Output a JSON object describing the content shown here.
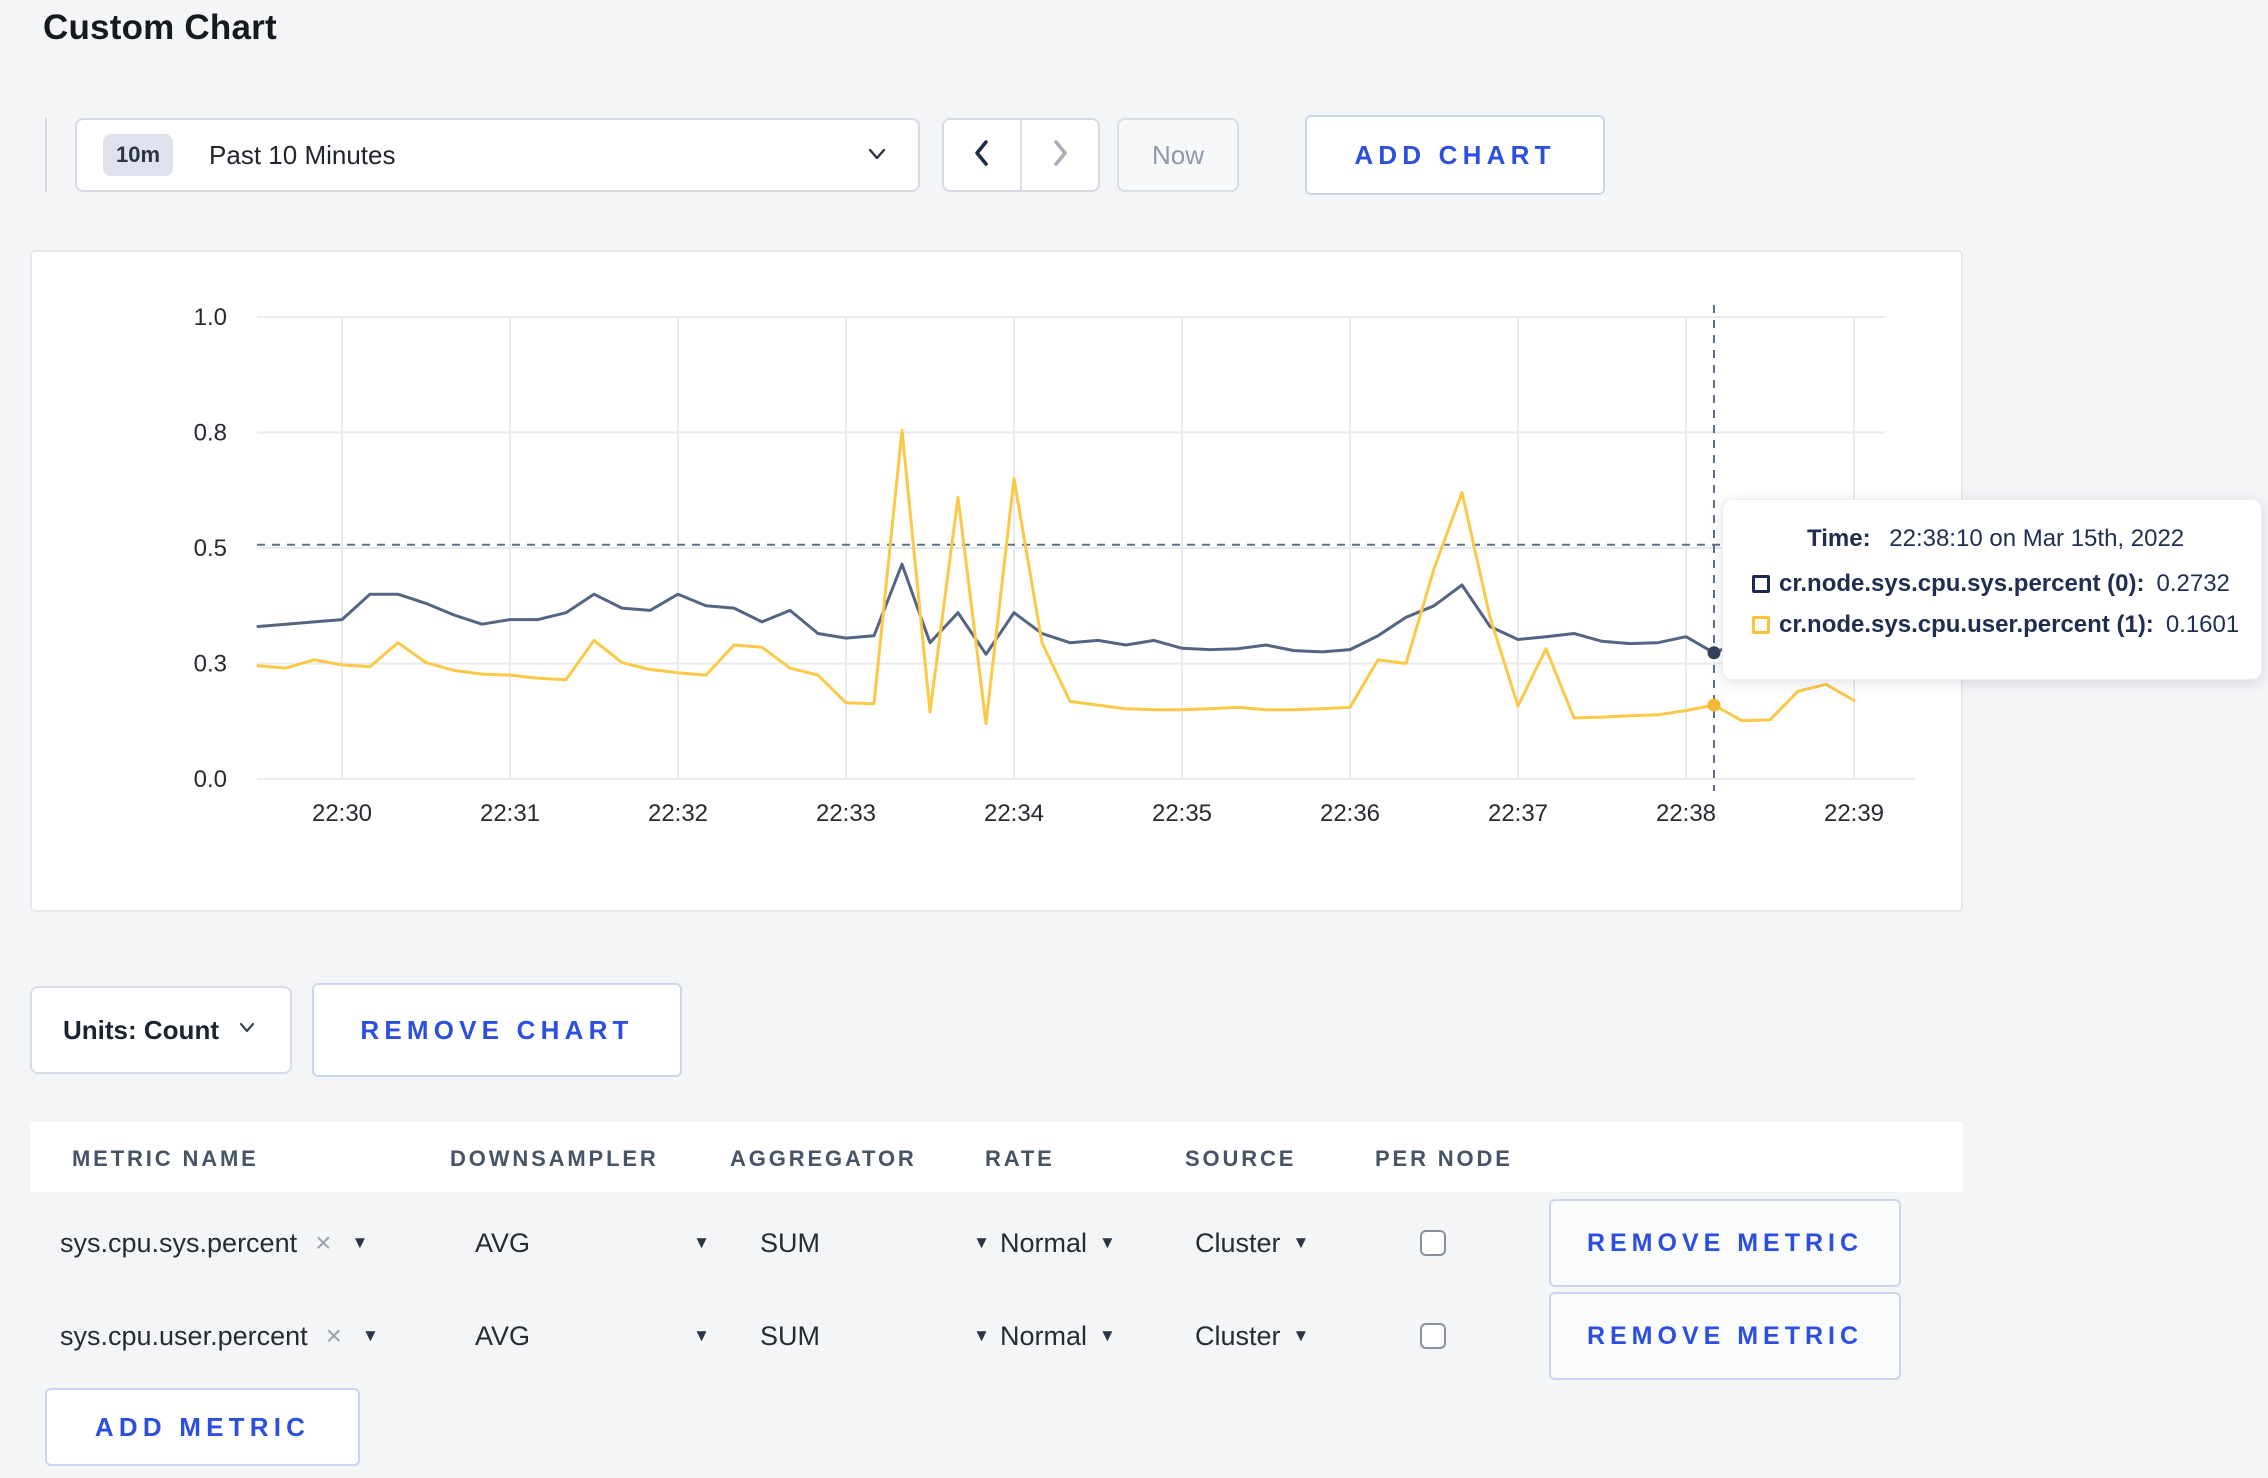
{
  "page": {
    "title": "Custom Chart"
  },
  "toolbar": {
    "time_window_badge": "10m",
    "time_window_label": "Past 10 Minutes",
    "now_label": "Now",
    "add_chart_label": "ADD CHART"
  },
  "chart_data": {
    "type": "line",
    "title": "",
    "xlabel": "",
    "ylabel": "",
    "x_tick_labels": [
      "22:30",
      "22:31",
      "22:32",
      "22:33",
      "22:34",
      "22:35",
      "22:36",
      "22:37",
      "22:38",
      "22:39"
    ],
    "y_tick_values": [
      0,
      0.25,
      0.5,
      0.75,
      1.0
    ],
    "y_tick_labels": [
      "0.0",
      "0.3",
      "0.5",
      "0.8",
      "1.0"
    ],
    "ylim": [
      0,
      1
    ],
    "grid": true,
    "x_start_time": "22:29:30",
    "sample_interval_seconds": 10,
    "series": [
      {
        "name": "cr.node.sys.cpu.sys.percent (0)",
        "color": "#546584",
        "values": [
          0.33,
          0.335,
          0.34,
          0.345,
          0.4,
          0.4,
          0.38,
          0.355,
          0.335,
          0.345,
          0.345,
          0.36,
          0.4,
          0.37,
          0.365,
          0.4,
          0.375,
          0.37,
          0.34,
          0.365,
          0.315,
          0.305,
          0.31,
          0.465,
          0.295,
          0.36,
          0.27,
          0.36,
          0.315,
          0.295,
          0.3,
          0.29,
          0.3,
          0.283,
          0.28,
          0.282,
          0.29,
          0.278,
          0.275,
          0.28,
          0.31,
          0.35,
          0.375,
          0.42,
          0.33,
          0.302,
          0.308,
          0.315,
          0.298,
          0.293,
          0.295,
          0.308,
          0.2732,
          0.298,
          0.3,
          0.305,
          0.308,
          0.3
        ]
      },
      {
        "name": "cr.node.sys.cpu.user.percent (1)",
        "color": "#fcc848",
        "values": [
          0.245,
          0.24,
          0.258,
          0.247,
          0.243,
          0.295,
          0.252,
          0.235,
          0.227,
          0.225,
          0.218,
          0.215,
          0.3,
          0.252,
          0.237,
          0.23,
          0.225,
          0.29,
          0.285,
          0.24,
          0.225,
          0.165,
          0.163,
          0.755,
          0.145,
          0.61,
          0.12,
          0.65,
          0.295,
          0.168,
          0.16,
          0.152,
          0.15,
          0.15,
          0.152,
          0.155,
          0.15,
          0.15,
          0.152,
          0.155,
          0.258,
          0.25,
          0.455,
          0.62,
          0.35,
          0.158,
          0.282,
          0.132,
          0.134,
          0.137,
          0.139,
          0.148,
          0.1601,
          0.126,
          0.128,
          0.19,
          0.205,
          0.17
        ]
      }
    ],
    "crosshair": {
      "time": "22:38:10",
      "index": 52,
      "h_value": 0.507,
      "dot_values": [
        0.2732,
        0.1601
      ],
      "dot_colors": [
        "#36435c",
        "#f5b836"
      ]
    }
  },
  "tooltip": {
    "time_label": "Time:",
    "time_value": "22:38:10 on Mar 15th, 2022",
    "series": [
      {
        "label": "cr.node.sys.cpu.sys.percent (0):",
        "value": "0.2732",
        "swatch_color": "#1b2a4e"
      },
      {
        "label": "cr.node.sys.cpu.user.percent (1):",
        "value": "0.1601",
        "swatch_color": "#fdc333"
      }
    ]
  },
  "chart_controls": {
    "units_label": "Units: Count",
    "remove_chart_label": "REMOVE CHART"
  },
  "metrics_table": {
    "headers": [
      "METRIC NAME",
      "DOWNSAMPLER",
      "AGGREGATOR",
      "RATE",
      "SOURCE",
      "PER NODE"
    ],
    "rows": [
      {
        "metric_name": "sys.cpu.sys.percent",
        "remove_tag": "×",
        "downsampler": "AVG",
        "aggregator": "SUM",
        "rate": "Normal",
        "source": "Cluster",
        "per_node_checked": false,
        "remove_label": "REMOVE METRIC"
      },
      {
        "metric_name": "sys.cpu.user.percent",
        "remove_tag": "×",
        "downsampler": "AVG",
        "aggregator": "SUM",
        "rate": "Normal",
        "source": "Cluster",
        "per_node_checked": false,
        "remove_label": "REMOVE METRIC"
      }
    ],
    "add_metric_label": "ADD METRIC",
    "caret_glyph": "▼"
  },
  "colors": {
    "accent_blue": "#2c4fe0",
    "grid": "#e8eaee",
    "crosshair": "#5c7086"
  }
}
